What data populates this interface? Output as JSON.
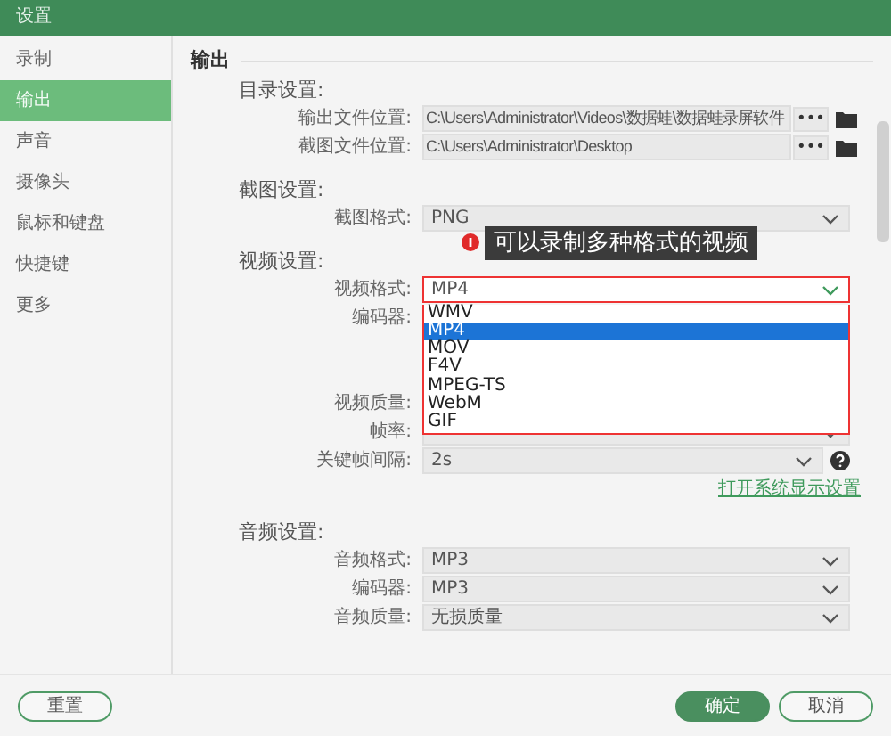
{
  "window": {
    "title": "设置"
  },
  "sidebar": {
    "items": [
      {
        "label": "录制",
        "selected": false
      },
      {
        "label": "输出",
        "selected": true
      },
      {
        "label": "声音",
        "selected": false
      },
      {
        "label": "摄像头",
        "selected": false
      },
      {
        "label": "鼠标和键盘",
        "selected": false
      },
      {
        "label": "快捷键",
        "selected": false
      },
      {
        "label": "更多",
        "selected": false
      }
    ]
  },
  "section_title": "输出",
  "groups": [
    {
      "heading": "目录设置:",
      "fields": [
        {
          "kind": "path",
          "label": "输出文件位置:",
          "value": "C:\\Users\\Administrator\\Videos\\数据蛙\\数据蛙录屏软件",
          "browse": "•••"
        },
        {
          "kind": "path",
          "label": "截图文件位置:",
          "value": "C:\\Users\\Administrator\\Desktop",
          "browse": "•••"
        }
      ]
    },
    {
      "heading": "截图设置:",
      "fields": [
        {
          "kind": "select",
          "label": "截图格式:",
          "value": "PNG"
        }
      ]
    },
    {
      "heading": "视频设置:",
      "tooltip": "可以录制多种格式的视频",
      "fields": [
        {
          "kind": "select",
          "label": "视频格式:",
          "value": "MP4",
          "highlighted": true,
          "options": [
            {
              "label": "WMV",
              "selected": false
            },
            {
              "label": "MP4",
              "selected": true
            },
            {
              "label": "MOV",
              "selected": false
            },
            {
              "label": "F4V",
              "selected": false
            },
            {
              "label": "MPEG-TS",
              "selected": false
            },
            {
              "label": "WebM",
              "selected": false
            },
            {
              "label": "GIF",
              "selected": false
            }
          ]
        },
        {
          "kind": "covered",
          "label": "编码器:"
        },
        {
          "kind": "covered",
          "label": "视频质量:"
        },
        {
          "kind": "select",
          "label": "帧率:"
        },
        {
          "kind": "select",
          "label": "关键帧间隔:",
          "value": "2s",
          "help": true
        }
      ],
      "link": "打开系统显示设置"
    },
    {
      "heading": "音频设置:",
      "fields": [
        {
          "kind": "select",
          "label": "音频格式:",
          "value": "MP3"
        },
        {
          "kind": "select",
          "label": "编码器:",
          "value": "MP3"
        },
        {
          "kind": "select",
          "label": "音频质量:",
          "value": "无损质量"
        }
      ]
    }
  ],
  "footer": {
    "reset": "重置",
    "ok": "确定",
    "cancel": "取消"
  }
}
